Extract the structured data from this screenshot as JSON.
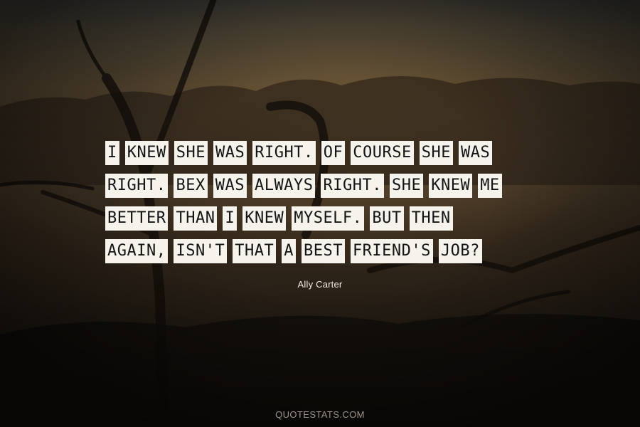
{
  "quote": {
    "lines": [
      [
        "I",
        "KNEW",
        "SHE",
        "WAS",
        "RIGHT.",
        "OF",
        "COURSE",
        "SHE",
        "WAS"
      ],
      [
        "RIGHT.",
        "BEX",
        "WAS",
        "ALWAYS",
        "RIGHT.",
        "SHE",
        "KNEW",
        "ME"
      ],
      [
        "BETTER",
        "THAN",
        "I",
        "KNEW",
        "MYSELF.",
        "BUT",
        "THEN"
      ],
      [
        "AGAIN,",
        "ISN'T",
        "THAT",
        "A",
        "BEST",
        "FRIEND'S",
        "JOB?"
      ]
    ]
  },
  "author": "Ally Carter",
  "watermark": "QUOTESTATS.COM"
}
